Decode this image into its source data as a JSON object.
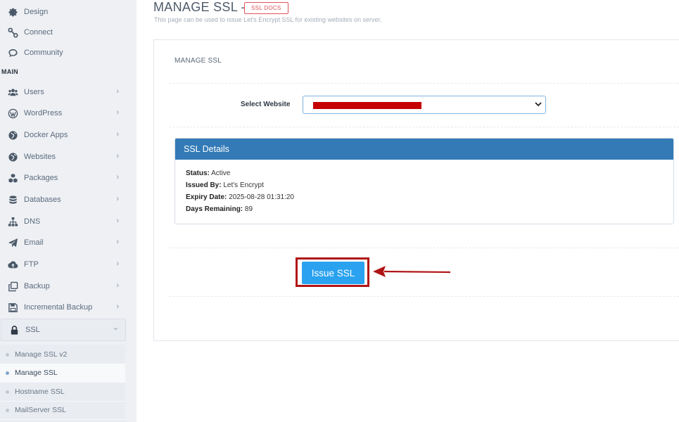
{
  "sidebar": {
    "top_items": [
      {
        "label": "Design",
        "icon": "gear-icon"
      },
      {
        "label": "Connect",
        "icon": "link-icon"
      },
      {
        "label": "Community",
        "icon": "chat-icon"
      }
    ],
    "section_label": "MAIN",
    "items": [
      {
        "label": "Users",
        "icon": "users-icon",
        "chevron": "›"
      },
      {
        "label": "WordPress",
        "icon": "wordpress-icon",
        "chevron": "›"
      },
      {
        "label": "Docker Apps",
        "icon": "globe-icon",
        "chevron": "›"
      },
      {
        "label": "Websites",
        "icon": "globe-icon",
        "chevron": "›"
      },
      {
        "label": "Packages",
        "icon": "cubes-icon",
        "chevron": "›"
      },
      {
        "label": "Databases",
        "icon": "database-icon",
        "chevron": "›"
      },
      {
        "label": "DNS",
        "icon": "sitemap-icon",
        "chevron": "›"
      },
      {
        "label": "Email",
        "icon": "paper-plane-icon",
        "chevron": "›"
      },
      {
        "label": "FTP",
        "icon": "cloud-upload-icon",
        "chevron": "›"
      },
      {
        "label": "Backup",
        "icon": "clone-icon",
        "chevron": "›"
      },
      {
        "label": "Incremental Backup",
        "icon": "save-icon",
        "chevron": "›"
      },
      {
        "label": "SSL",
        "icon": "lock-icon",
        "chevron": "⌄"
      }
    ],
    "ssl_submenu": [
      {
        "label": "Manage SSL v2",
        "current": false
      },
      {
        "label": "Manage SSL",
        "current": true
      },
      {
        "label": "Hostname SSL",
        "current": false
      },
      {
        "label": "MailServer SSL",
        "current": false
      }
    ]
  },
  "header": {
    "title": "MANAGE SSL -",
    "docs_badge": "SSL DOCS",
    "subtitle": "This page can be used to issue Let's Encrypt SSL for existing websites on server."
  },
  "card": {
    "heading": "MANAGE SSL",
    "select_label": "Select Website",
    "select_value_redacted": true
  },
  "ssl_details": {
    "title": "SSL Details",
    "status_label": "Status:",
    "status_value": "Active",
    "issuer_label": "Issued By:",
    "issuer_value": "Let's Encrypt",
    "expiry_label": "Expiry Date:",
    "expiry_value": "2025-08-28 01:31:20",
    "days_label": "Days Remaining:",
    "days_value": "89"
  },
  "actions": {
    "issue_label": "Issue SSL"
  },
  "colors": {
    "panel_header": "#337ab7",
    "issue_button": "#2aa2f0",
    "highlight": "#b01414",
    "badge": "#e2525a"
  }
}
